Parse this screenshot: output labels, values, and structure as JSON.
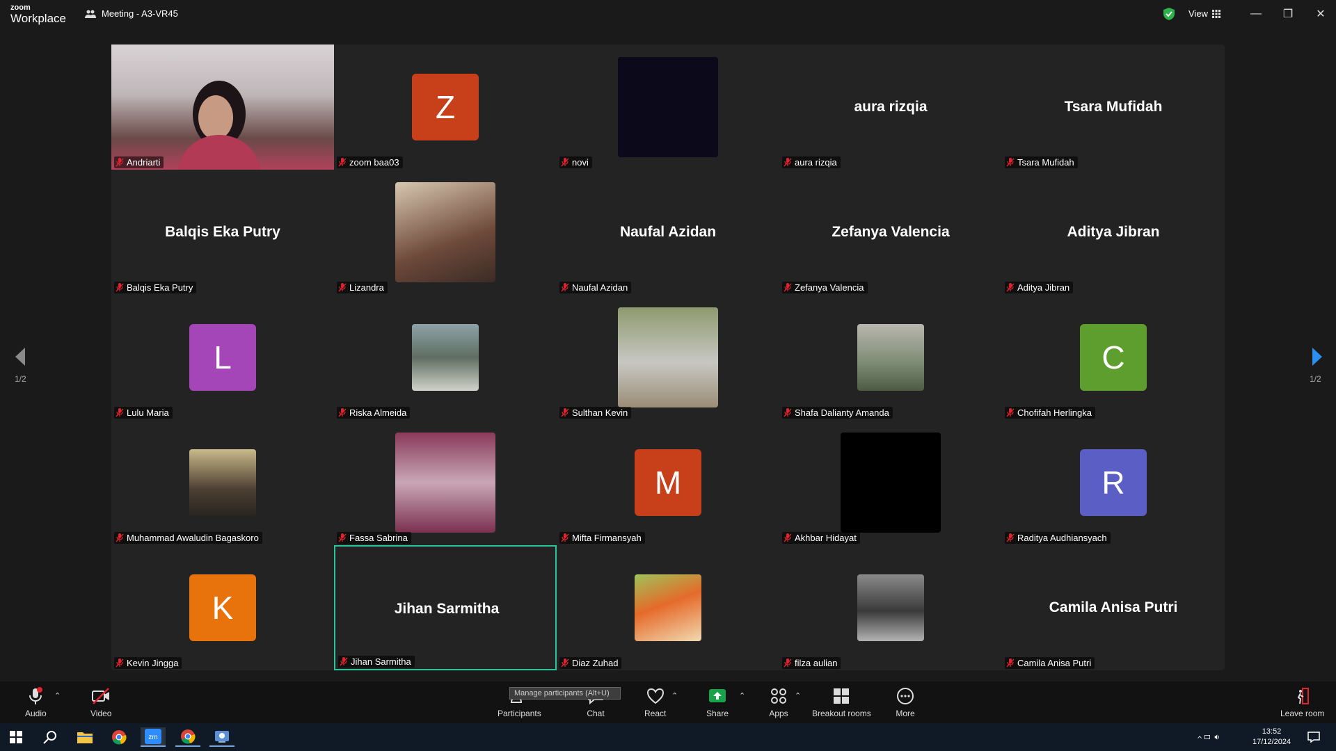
{
  "app": {
    "logo_line1": "zoom",
    "logo_line2": "Workplace",
    "meeting_title": "Meeting - A3-VR45",
    "view_label": "View"
  },
  "window_controls": {
    "minimize": "—",
    "restore": "❐",
    "close": "✕"
  },
  "pagination": {
    "left": "1/2",
    "right": "1/2"
  },
  "tiles": [
    {
      "label": "Andriarti",
      "kind": "video"
    },
    {
      "label": "zoom baa03",
      "kind": "avatar",
      "letter": "Z",
      "color": "#c8401a"
    },
    {
      "label": "novi",
      "kind": "dark"
    },
    {
      "label": "aura rizqia",
      "kind": "name",
      "big": "aura rizqia"
    },
    {
      "label": "Tsara Mufidah",
      "kind": "name",
      "big": "Tsara Mufidah"
    },
    {
      "label": "Balqis Eka Putry",
      "kind": "name",
      "big": "Balqis Eka Putry"
    },
    {
      "label": "Lizandra",
      "kind": "photo"
    },
    {
      "label": "Naufal Azidan",
      "kind": "name",
      "big": "Naufal Azidan"
    },
    {
      "label": "Zefanya Valencia",
      "kind": "name",
      "big": "Zefanya Valencia"
    },
    {
      "label": "Aditya Jibran",
      "kind": "name",
      "big": "Aditya Jibran"
    },
    {
      "label": "Lulu Maria",
      "kind": "avatar",
      "letter": "L",
      "color": "#a446b8"
    },
    {
      "label": "Riska Almeida",
      "kind": "photo"
    },
    {
      "label": "Sulthan Kevin",
      "kind": "photo"
    },
    {
      "label": "Shafa Dalianty Amanda",
      "kind": "photo"
    },
    {
      "label": "Chofifah Herlingka",
      "kind": "avatar",
      "letter": "C",
      "color": "#5e9e2f"
    },
    {
      "label": "Muhammad Awaludin Bagaskoro",
      "kind": "photo"
    },
    {
      "label": "Fassa Sabrina",
      "kind": "photo"
    },
    {
      "label": "Mifta Firmansyah",
      "kind": "avatar",
      "letter": "M",
      "color": "#c8401a"
    },
    {
      "label": "Akhbar Hidayat",
      "kind": "black"
    },
    {
      "label": "Raditya Audhiansyach",
      "kind": "avatar",
      "letter": "R",
      "color": "#5b5ec4"
    },
    {
      "label": "Kevin Jingga",
      "kind": "avatar",
      "letter": "K",
      "color": "#e8720c"
    },
    {
      "label": "Jihan Sarmitha",
      "kind": "name",
      "big": "Jihan Sarmitha",
      "active": true
    },
    {
      "label": "Diaz Zuhad",
      "kind": "photo"
    },
    {
      "label": "filza aulian",
      "kind": "photo"
    },
    {
      "label": "Camila Anisa Putri",
      "kind": "name",
      "big": "Camila Anisa Putri"
    }
  ],
  "toolbar": {
    "audio": "Audio",
    "video": "Video",
    "participants": "Participants",
    "chat": "Chat",
    "react": "React",
    "share": "Share",
    "apps": "Apps",
    "breakout": "Breakout rooms",
    "more": "More",
    "leave": "Leave room",
    "tooltip": "Manage participants (Alt+U)",
    "share_color": "#16a34a",
    "accent": "#2ac59a",
    "alert_color": "#e0242f"
  },
  "taskbar": {
    "time": "13:52",
    "date": "17/12/2024"
  }
}
